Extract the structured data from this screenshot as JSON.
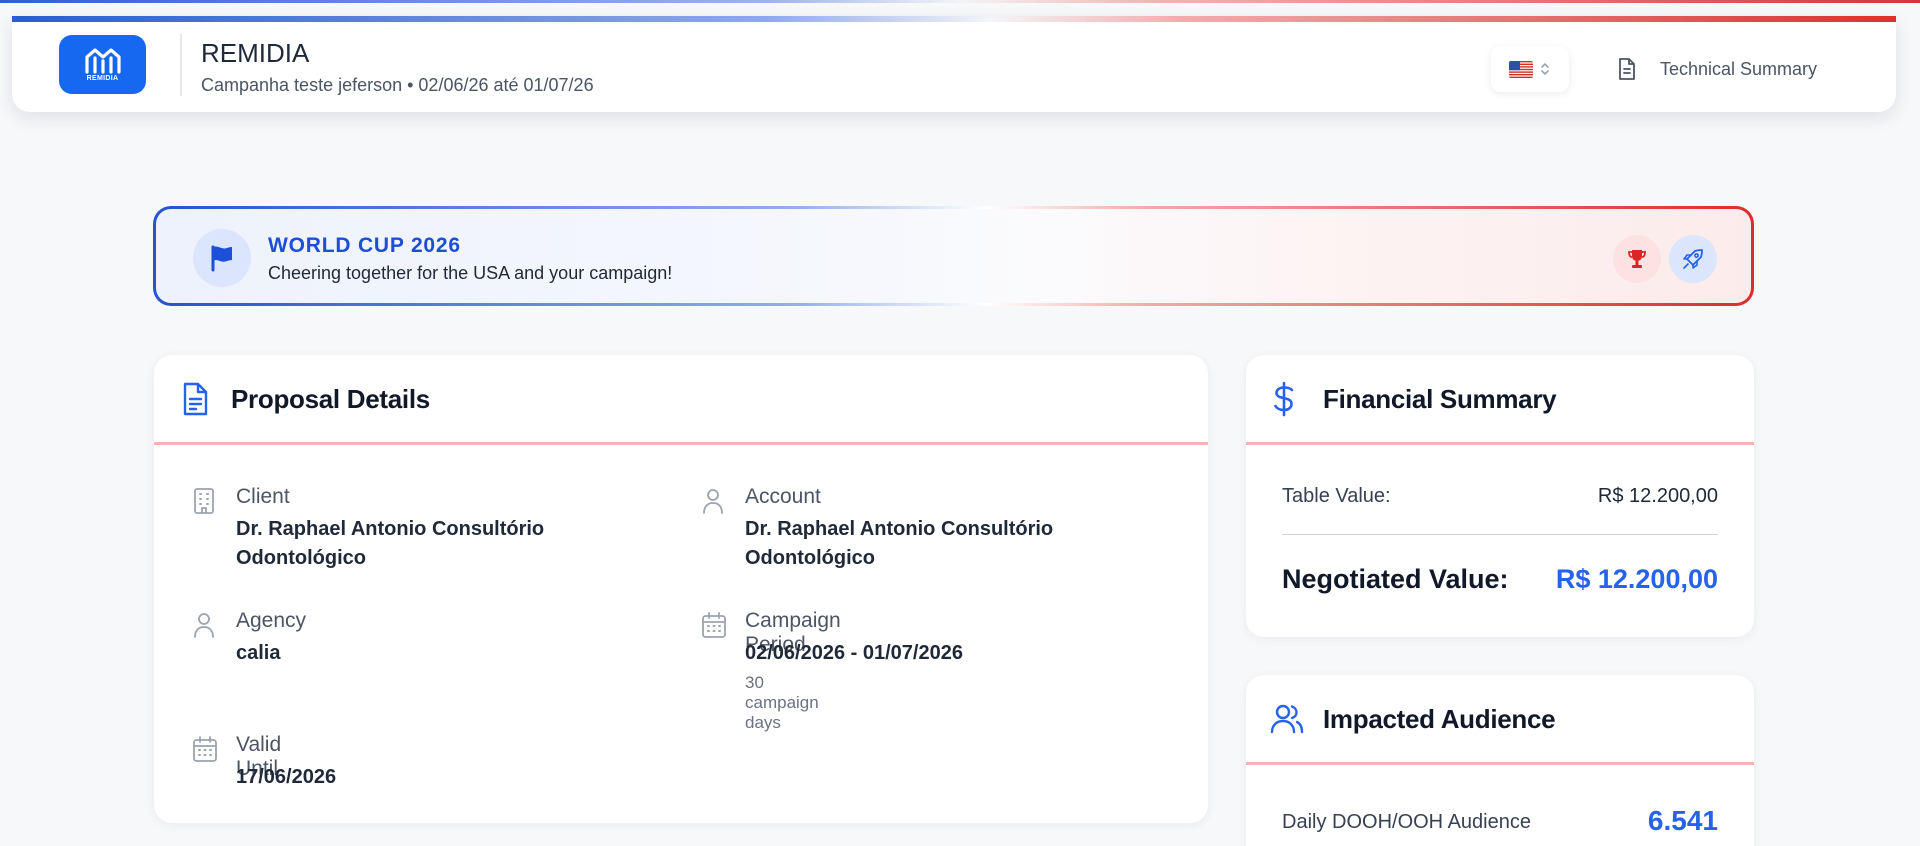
{
  "header": {
    "logo_text": "REMIDIA",
    "title": "REMIDIA",
    "subtitle": "Campanha teste jeferson • 02/06/26 até 01/07/26",
    "language_icon": "us-flag-icon",
    "technical_summary_label": "Technical Summary"
  },
  "banner": {
    "title": "WORLD CUP 2026",
    "subtitle": "Cheering together for the USA and your campaign!",
    "icons": [
      "flag-icon",
      "trophy-icon",
      "rocket-icon"
    ]
  },
  "proposal": {
    "title": "Proposal Details",
    "client_label": "Client",
    "client_value": "Dr. Raphael Antonio Consultório Odontológico",
    "account_label": "Account",
    "account_value": "Dr. Raphael Antonio Consultório Odontológico",
    "agency_label": "Agency",
    "agency_value": "calia",
    "period_label": "Campaign Period",
    "period_value": "02/06/2026 - 01/07/2026",
    "period_note": "30 campaign days",
    "valid_label": "Valid Until",
    "valid_value": "17/06/2026"
  },
  "financial": {
    "title": "Financial Summary",
    "table_label": "Table Value:",
    "table_value": "R$ 12.200,00",
    "negotiated_label": "Negotiated Value:",
    "negotiated_value": "R$ 12.200,00"
  },
  "audience": {
    "title": "Impacted Audience",
    "daily_label": "Daily DOOH/OOH Audience",
    "daily_value": "6.541"
  },
  "colors": {
    "primary_blue": "#1668f0",
    "accent_blue": "#2563eb",
    "accent_red": "#dc2626",
    "divider_pink": "#f8b4b4"
  }
}
